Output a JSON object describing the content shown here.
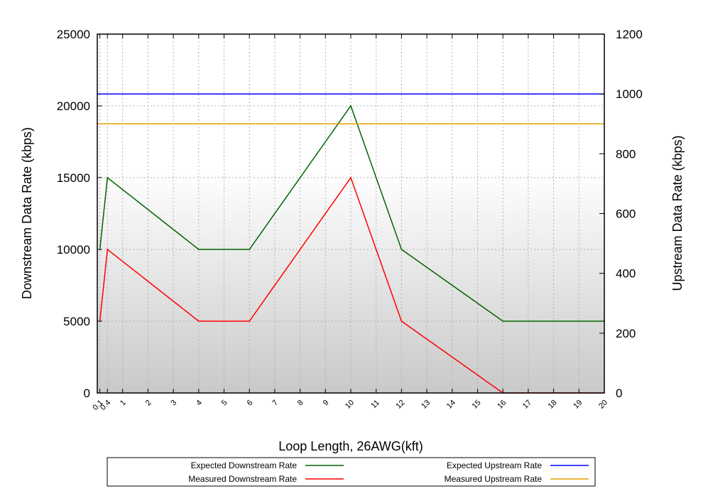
{
  "chart_data": {
    "type": "line",
    "xlabel": "Loop Length, 26AWG(kft)",
    "ylabel_left": "Downstream Data Rate (kbps)",
    "ylabel_right": "Upstream Data Rate (kbps)",
    "xlim": [
      0,
      20
    ],
    "ylim_left": [
      0,
      25000
    ],
    "ylim_right": [
      0,
      1200
    ],
    "x_ticks": [
      "0.1",
      "0.4",
      "1",
      "2",
      "3",
      "4",
      "5",
      "6",
      "7",
      "8",
      "9",
      "10",
      "11",
      "12",
      "13",
      "14",
      "15",
      "16",
      "17",
      "18",
      "19",
      "20"
    ],
    "y_ticks_left": [
      "0",
      "5000",
      "10000",
      "15000",
      "20000",
      "25000"
    ],
    "y_ticks_right": [
      "0",
      "200",
      "400",
      "600",
      "800",
      "1000",
      "1200"
    ],
    "grid": true,
    "legend_position": "bottom",
    "series": [
      {
        "name": "Expected Downstream Rate",
        "axis": "left",
        "color": "#006400",
        "x": [
          0.1,
          0.4,
          4,
          6,
          10,
          12,
          16,
          20
        ],
        "y": [
          10000,
          15000,
          10000,
          10000,
          20000,
          10000,
          5000,
          5000
        ]
      },
      {
        "name": "Measured Downstream Rate",
        "axis": "left",
        "color": "#ff0000",
        "x": [
          0.1,
          0.4,
          4,
          6,
          10,
          12,
          16,
          20
        ],
        "y": [
          5000,
          10000,
          5000,
          5000,
          15000,
          5000,
          0,
          0
        ]
      },
      {
        "name": "Expected Upstream Rate",
        "axis": "right",
        "color": "#0000ff",
        "x": [
          0,
          20
        ],
        "y": [
          1000,
          1000
        ]
      },
      {
        "name": "Measured Upstream Rate",
        "axis": "right",
        "color": "#e5a000",
        "x": [
          0,
          20
        ],
        "y": [
          900,
          900
        ]
      }
    ]
  }
}
